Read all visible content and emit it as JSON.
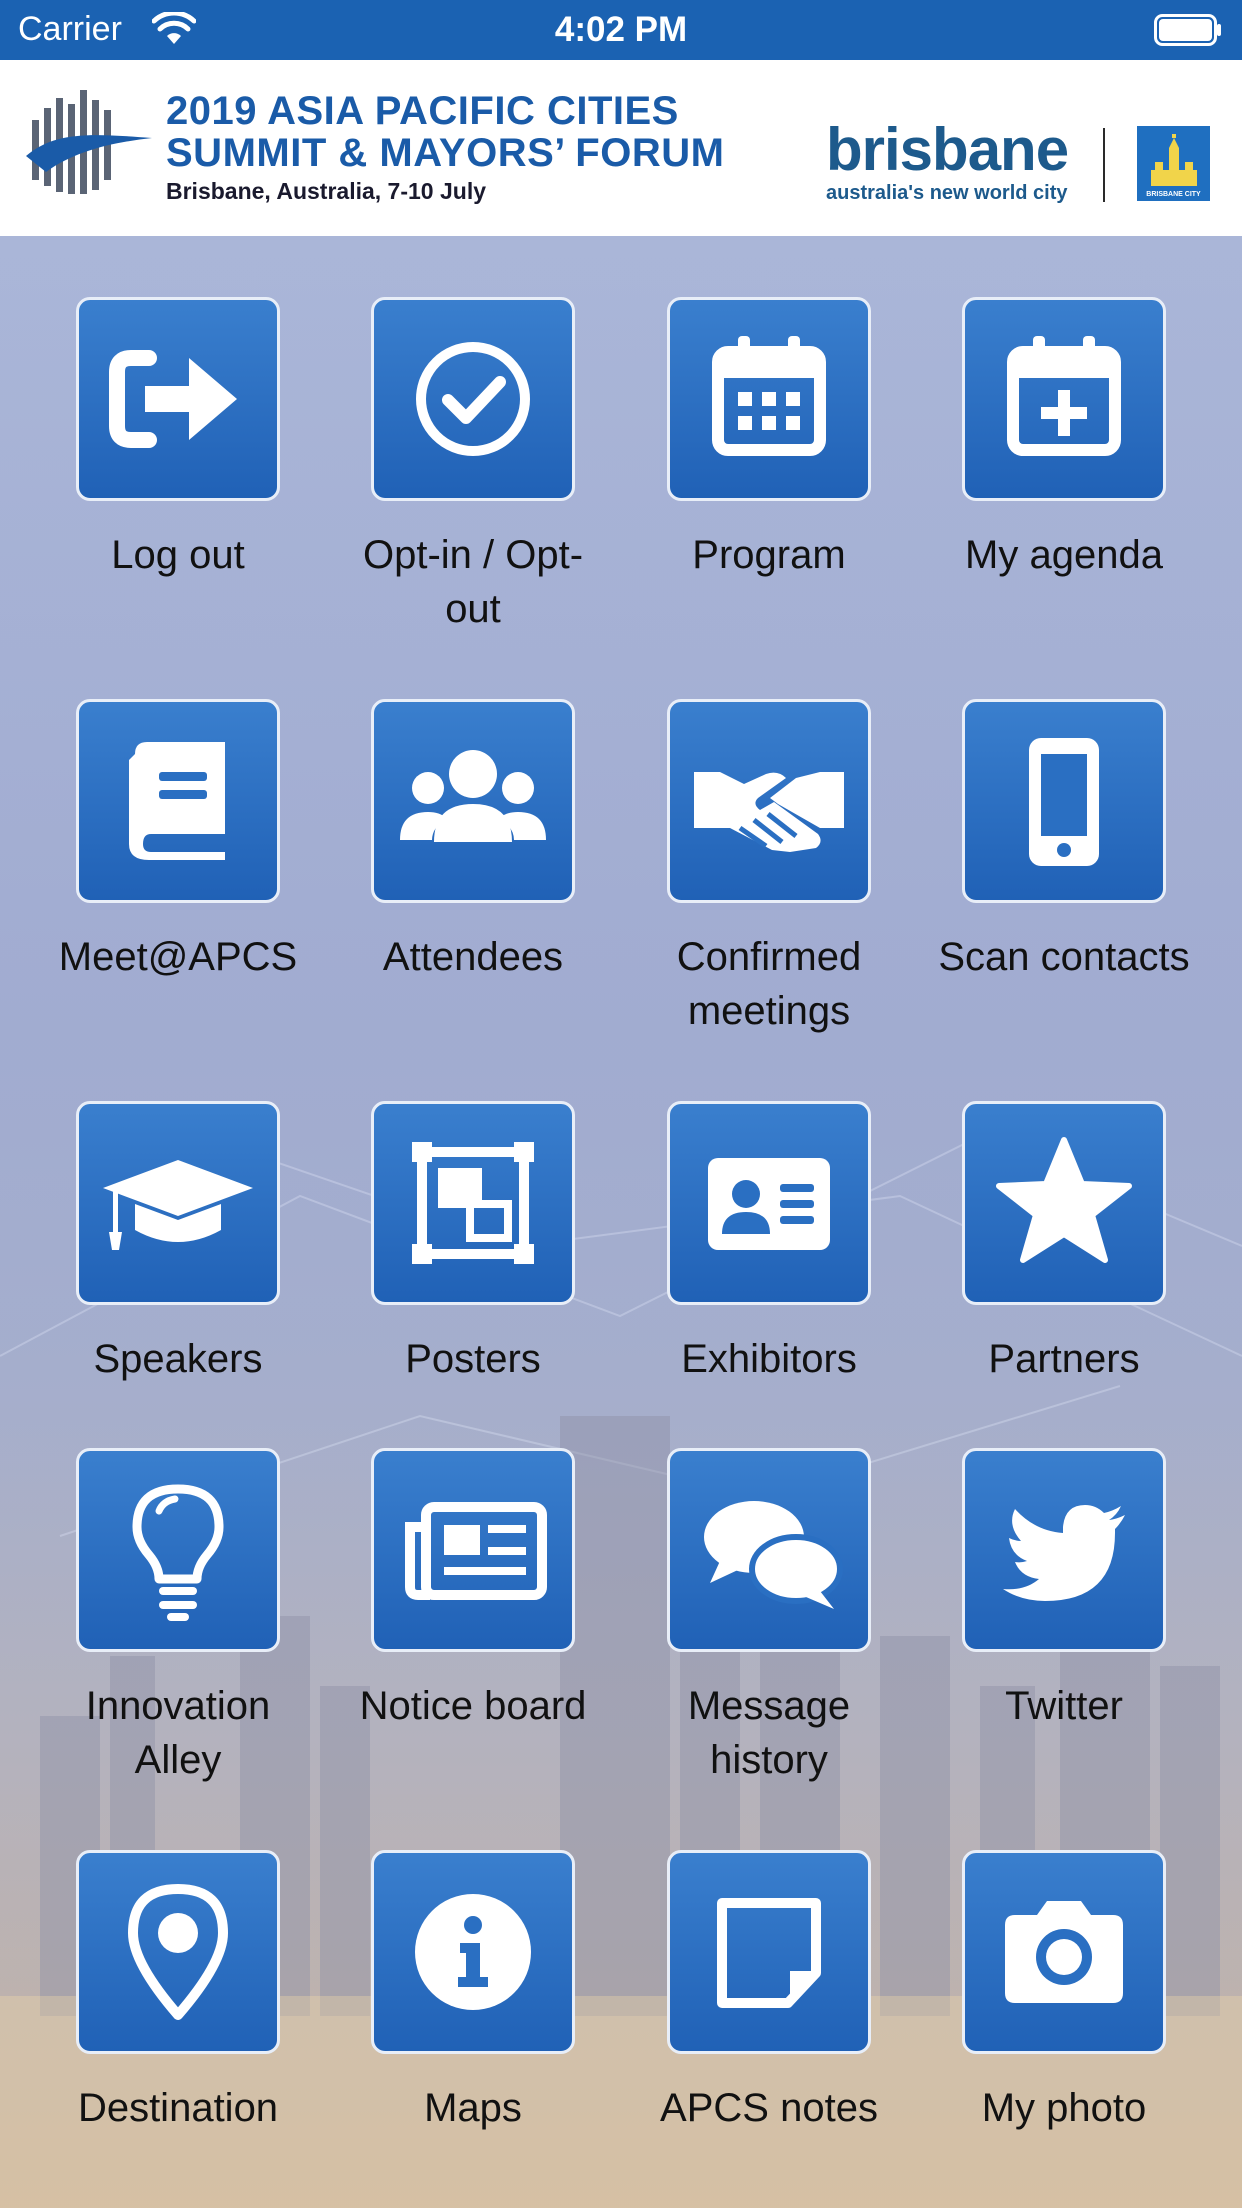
{
  "status_bar": {
    "carrier": "Carrier",
    "time": "4:02 PM"
  },
  "header": {
    "title_line1": "2019 ASIA PACIFIC CITIES",
    "title_line2": "SUMMIT & MAYORS’ FORUM",
    "subtitle": "Brisbane, Australia, 7-10 July",
    "brand_name": "brisbane",
    "brand_tagline": "australia's new world city",
    "badge_text": "BRISBANE CITY"
  },
  "colors": {
    "tile": "#2a6fc2",
    "status_bar": "#1b62b2",
    "brand": "#1d5a8c"
  },
  "menu": [
    {
      "label": "Log out",
      "icon": "logout-icon"
    },
    {
      "label": "Opt-in / Opt-out",
      "icon": "check-circle-icon"
    },
    {
      "label": "Program",
      "icon": "calendar-icon"
    },
    {
      "label": "My agenda",
      "icon": "calendar-plus-icon"
    },
    {
      "label": "Meet@APCS",
      "icon": "book-icon"
    },
    {
      "label": "Attendees",
      "icon": "people-icon"
    },
    {
      "label": "Confirmed meetings",
      "icon": "handshake-icon"
    },
    {
      "label": "Scan contacts",
      "icon": "mobile-phone-icon"
    },
    {
      "label": "Speakers",
      "icon": "graduation-cap-icon"
    },
    {
      "label": "Posters",
      "icon": "poster-frame-icon"
    },
    {
      "label": "Exhibitors",
      "icon": "id-card-icon"
    },
    {
      "label": "Partners",
      "icon": "star-icon"
    },
    {
      "label": "Innovation Alley",
      "icon": "lightbulb-icon"
    },
    {
      "label": "Notice board",
      "icon": "newspaper-icon"
    },
    {
      "label": "Message history",
      "icon": "chat-bubbles-icon"
    },
    {
      "label": "Twitter",
      "icon": "twitter-bird-icon"
    },
    {
      "label": "Destination",
      "icon": "map-pin-icon"
    },
    {
      "label": "Maps",
      "icon": "info-icon"
    },
    {
      "label": "APCS notes",
      "icon": "sticky-note-icon"
    },
    {
      "label": "My photo",
      "icon": "camera-icon"
    }
  ]
}
